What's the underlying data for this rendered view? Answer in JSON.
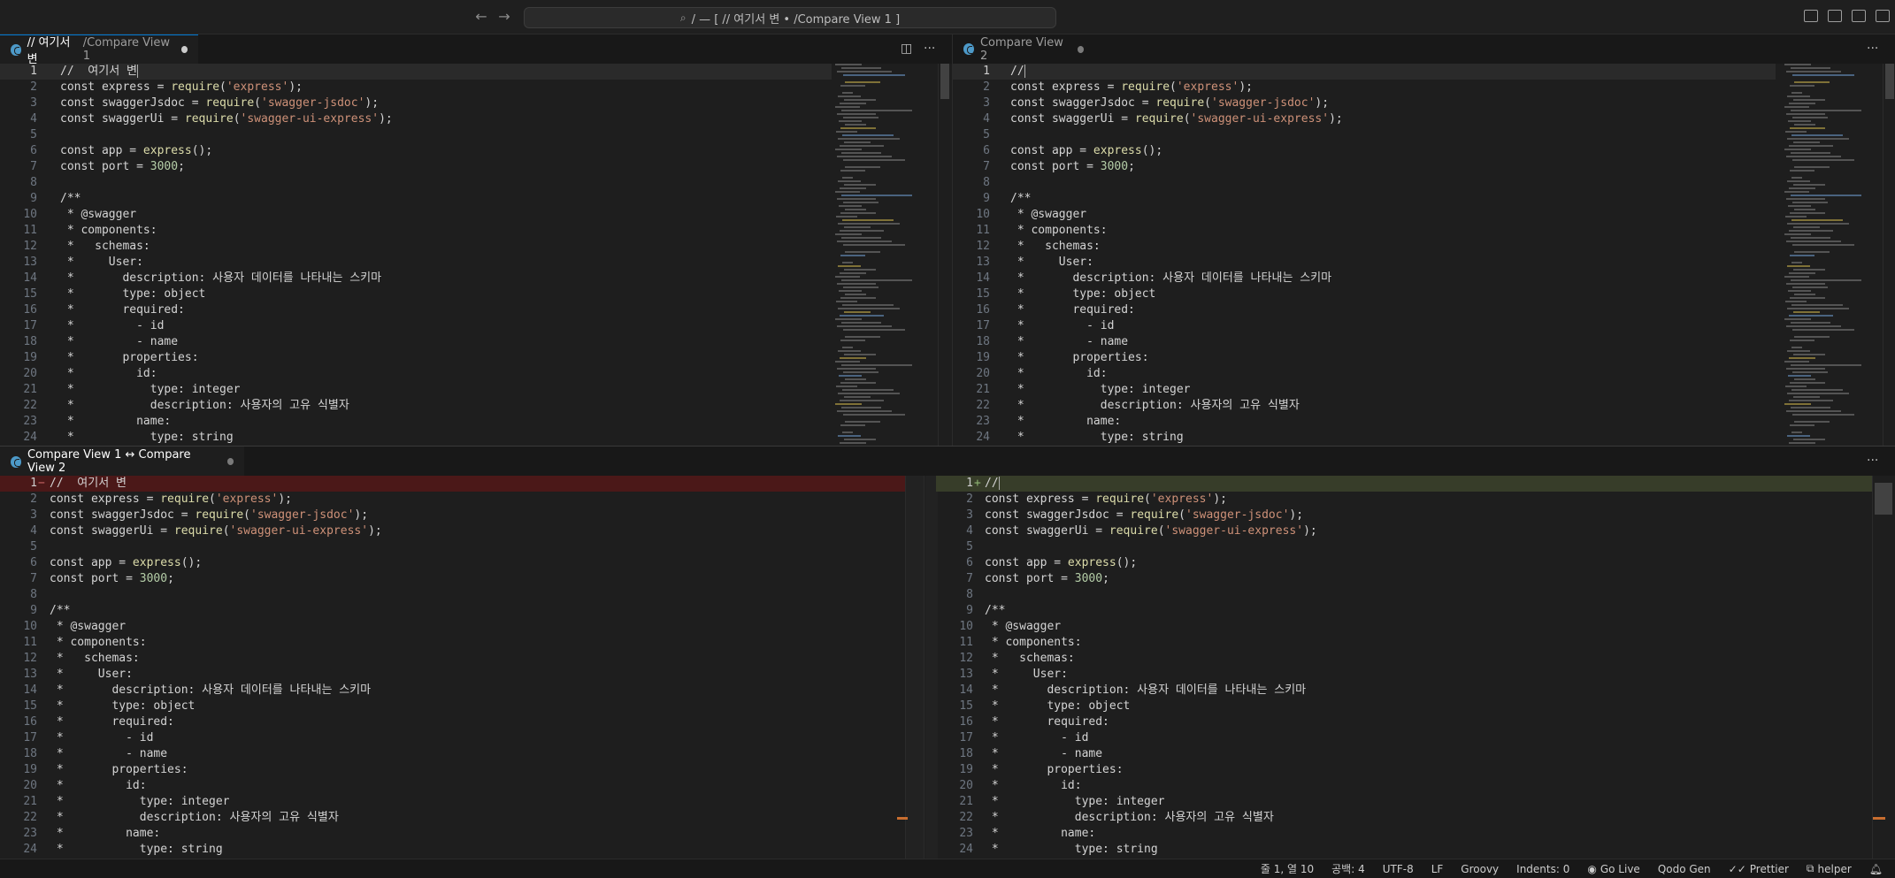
{
  "titlebar": {
    "back_arrow": "←",
    "forward_arrow": "→",
    "command_center_text": "/ — [ // 여기서 변 • /Compare View 1 ]"
  },
  "groups": {
    "top_left": {
      "tab_title": "// 여기서 변",
      "tab_path": "/Compare View 1"
    },
    "top_right": {
      "tab_title": "Compare View 2"
    },
    "bottom": {
      "tab_title": "Compare View 1 ↔ Compare View 2"
    }
  },
  "code_lines": [
    "const express = require('express');",
    "const swaggerJsdoc = require('swagger-jsdoc');",
    "const swaggerUi = require('swagger-ui-express');",
    "",
    "const app = express();",
    "const port = 3000;",
    "",
    "/**",
    " * @swagger",
    " * components:",
    " *   schemas:",
    " *     User:",
    " *       description: 사용자 데이터를 나타내는 스키마",
    " *       type: object",
    " *       required:",
    " *         - id",
    " *         - name",
    " *       properties:",
    " *         id:",
    " *           type: integer",
    " *           description: 사용자의 고유 식별자",
    " *         name:",
    " *           type: string"
  ],
  "first_line_left": "//  여기서 변",
  "first_line_right": "//",
  "line_numbers": [
    "1",
    "2",
    "3",
    "4",
    "5",
    "6",
    "7",
    "8",
    "9",
    "10",
    "11",
    "12",
    "13",
    "14",
    "15",
    "16",
    "17",
    "18",
    "19",
    "20",
    "21",
    "22",
    "23",
    "24"
  ],
  "statusbar": {
    "position": "줄 1, 열 10",
    "spaces": "공백: 4",
    "encoding": "UTF-8",
    "eol": "LF",
    "language": "Groovy",
    "indents": "Indents: 0",
    "go_live": "Go Live",
    "qodo": "Qodo Gen",
    "prettier": "Prettier",
    "helper": "helper"
  },
  "colors": {
    "keyword": "#d4d4d4",
    "string": "#ce9178",
    "number": "#b5cea8",
    "function": "#dcdcaa",
    "deleted_line": "#4b1818",
    "inserted_line": "#373d29",
    "accent": "#0078d4"
  },
  "icons": {
    "tab_file": "groovy-file-icon",
    "split_editor": "split-editor-icon",
    "more_actions": "ellipsis-icon",
    "search": "search-icon",
    "bell": "bell-icon"
  }
}
